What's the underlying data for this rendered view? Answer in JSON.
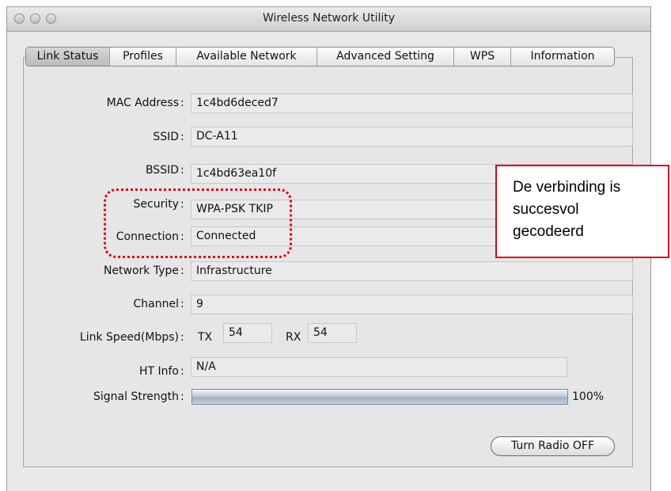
{
  "window": {
    "title": "Wireless Network Utility"
  },
  "tabs": [
    {
      "label": "Link Status",
      "active": true
    },
    {
      "label": "Profiles"
    },
    {
      "label": "Available Network"
    },
    {
      "label": "Advanced Setting"
    },
    {
      "label": "WPS"
    },
    {
      "label": "Information"
    }
  ],
  "fields": {
    "mac_label": "MAC Address",
    "mac_value": "1c4bd6deced7",
    "ssid_label": "SSID",
    "ssid_value": "DC-A11",
    "bssid_label": "BSSID",
    "bssid_value": "1c4bd63ea10f",
    "security_label": "Security",
    "security_value": "WPA-PSK TKIP",
    "connection_label": "Connection",
    "connection_value": "Connected",
    "network_type_label": "Network Type",
    "network_type_value": "Infrastructure",
    "channel_label": "Channel",
    "channel_value": "9",
    "link_speed_label": "Link Speed(Mbps)",
    "tx_label": "TX",
    "tx_value": "54",
    "rx_label": "RX",
    "rx_value": "54",
    "ht_info_label": "HT Info",
    "ht_info_value": "N/A",
    "signal_label": "Signal Strength",
    "signal_value": "100%",
    "signal_fraction": 1.0
  },
  "buttons": {
    "radio_off": "Turn Radio OFF"
  },
  "annotation": {
    "line1": "De verbinding is",
    "line2": "succesvol",
    "line3": "gecodeerd"
  },
  "colors": {
    "highlight": "#e0001a"
  }
}
